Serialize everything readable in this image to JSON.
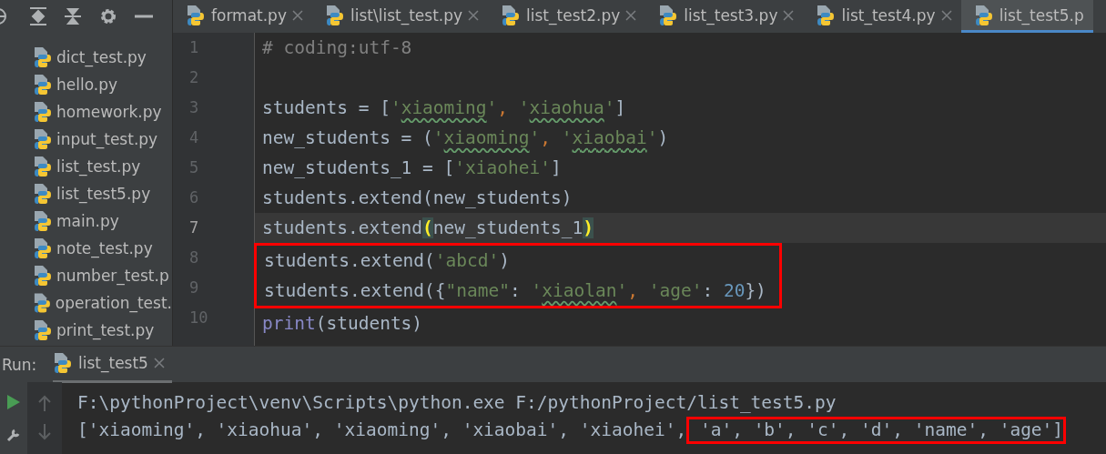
{
  "tabs": [
    {
      "label": "format.py",
      "selected": false
    },
    {
      "label": "list\\list_test.py",
      "selected": false
    },
    {
      "label": "list_test2.py",
      "selected": false
    },
    {
      "label": "list_test3.py",
      "selected": false
    },
    {
      "label": "list_test4.py",
      "selected": false
    },
    {
      "label": "list_test5.p",
      "selected": true
    }
  ],
  "sidebar": {
    "items": [
      {
        "label": "dict_test.py"
      },
      {
        "label": "hello.py"
      },
      {
        "label": "homework.py"
      },
      {
        "label": "input_test.py"
      },
      {
        "label": "list_test.py"
      },
      {
        "label": "list_test5.py"
      },
      {
        "label": "main.py"
      },
      {
        "label": "note_test.py"
      },
      {
        "label": "number_test.p"
      },
      {
        "label": "operation_test."
      },
      {
        "label": "print_test.py"
      }
    ]
  },
  "editor": {
    "lines": [
      {
        "number": "1",
        "current": false,
        "boxed": false,
        "tokens": [
          {
            "text": "# coding:utf-8",
            "kind": "comment"
          }
        ]
      },
      {
        "number": "2",
        "current": false,
        "boxed": false
      },
      {
        "number": "3",
        "current": false,
        "boxed": false,
        "tokens": [
          {
            "text": "students = [",
            "kind": "plain"
          },
          {
            "text": "'",
            "kind": "string"
          },
          {
            "text": "xiaoming",
            "kind": "string",
            "typo": true
          },
          {
            "text": "'",
            "kind": "string"
          },
          {
            "text": ", ",
            "kind": "comma"
          },
          {
            "text": "'",
            "kind": "string"
          },
          {
            "text": "xiaohua",
            "kind": "string",
            "typo": true
          },
          {
            "text": "'",
            "kind": "string"
          },
          {
            "text": "]",
            "kind": "plain"
          }
        ]
      },
      {
        "number": "4",
        "current": false,
        "boxed": false,
        "tokens": [
          {
            "text": "new_students = (",
            "kind": "plain"
          },
          {
            "text": "'",
            "kind": "string"
          },
          {
            "text": "xiaoming",
            "kind": "string",
            "typo": true
          },
          {
            "text": "'",
            "kind": "string"
          },
          {
            "text": ", ",
            "kind": "comma"
          },
          {
            "text": "'",
            "kind": "string"
          },
          {
            "text": "xiaobai",
            "kind": "string",
            "typo": true
          },
          {
            "text": "'",
            "kind": "string"
          },
          {
            "text": ")",
            "kind": "plain"
          }
        ]
      },
      {
        "number": "5",
        "current": false,
        "boxed": false,
        "tokens": [
          {
            "text": "new_students_1 = [",
            "kind": "plain"
          },
          {
            "text": "'xiaohei'",
            "kind": "string"
          },
          {
            "text": "]",
            "kind": "plain"
          }
        ]
      },
      {
        "number": "6",
        "current": false,
        "boxed": false,
        "tokens": [
          {
            "text": "students.extend(new_students)",
            "kind": "plain"
          }
        ]
      },
      {
        "number": "7",
        "current": true,
        "boxed": false,
        "tokens": [
          {
            "text": "students.extend",
            "kind": "plain"
          },
          {
            "text": "(",
            "kind": "match"
          },
          {
            "text": "new_students_1",
            "kind": "plain"
          },
          {
            "text": ")",
            "kind": "match"
          }
        ]
      },
      {
        "number": "8",
        "current": false,
        "boxed": true,
        "tokens": [
          {
            "text": "students.extend(",
            "kind": "plain"
          },
          {
            "text": "'abcd'",
            "kind": "string"
          },
          {
            "text": ")",
            "kind": "plain"
          }
        ]
      },
      {
        "number": "9",
        "current": false,
        "boxed": true,
        "tokens": [
          {
            "text": "students.extend({",
            "kind": "plain"
          },
          {
            "text": "\"name\"",
            "kind": "string"
          },
          {
            "text": ": ",
            "kind": "plain"
          },
          {
            "text": "'",
            "kind": "string"
          },
          {
            "text": "xiaolan",
            "kind": "string",
            "typo": true
          },
          {
            "text": "'",
            "kind": "string"
          },
          {
            "text": ", ",
            "kind": "comma"
          },
          {
            "text": "'age'",
            "kind": "string"
          },
          {
            "text": ": ",
            "kind": "plain"
          },
          {
            "text": "20",
            "kind": "number"
          },
          {
            "text": "})",
            "kind": "plain"
          }
        ]
      },
      {
        "number": "10",
        "current": false,
        "boxed": false,
        "tokens": [
          {
            "text": "print",
            "kind": "keyword"
          },
          {
            "text": "(students)",
            "kind": "plain"
          }
        ]
      }
    ]
  },
  "run_panel": {
    "label": "Run:",
    "tab": "list_test5",
    "output": [
      [
        {
          "text": "F:\\pythonProject\\venv\\Scripts\\python.exe F:/pythonProject/list_test5.py",
          "boxed": false
        }
      ],
      [
        {
          "text": "['xiaoming', 'xiaohua', 'xiaoming', 'xiaobai', 'xiaohei',",
          "boxed": false
        },
        {
          "text": " 'a', 'b', 'c', 'd', 'name', 'age']",
          "boxed": true
        }
      ]
    ]
  }
}
